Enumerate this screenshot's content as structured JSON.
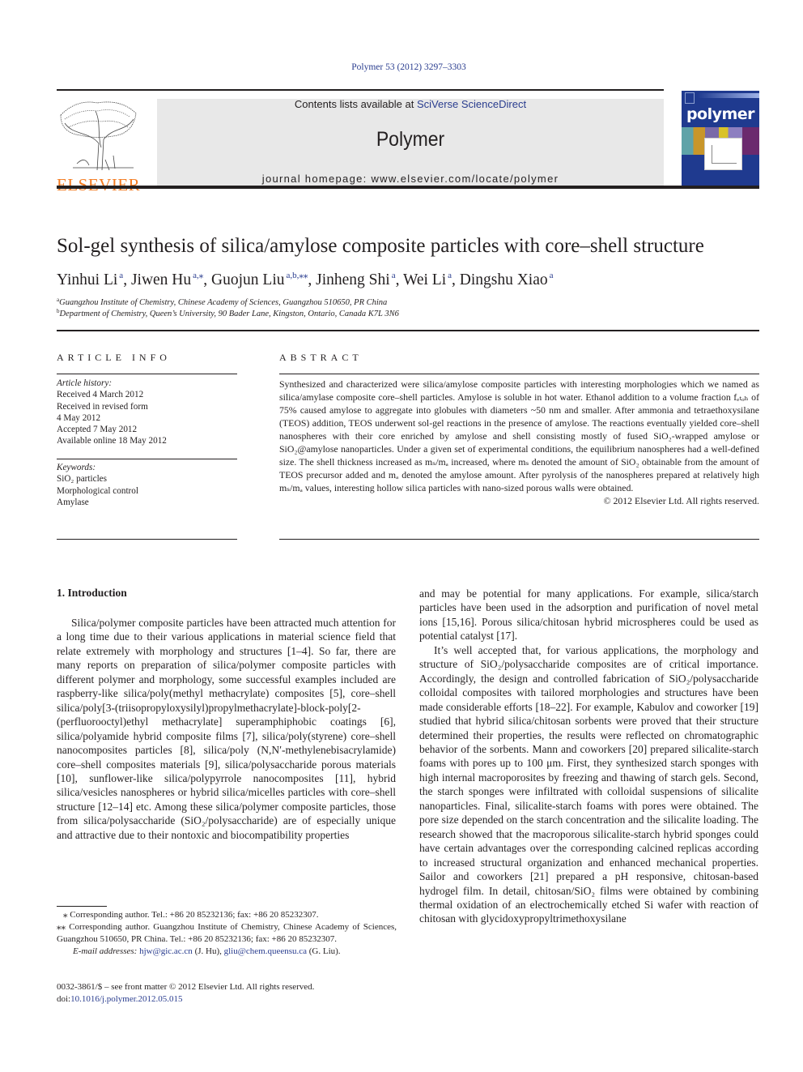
{
  "header": {
    "citation": "Polymer 53 (2012) 3297–3303",
    "contents_prefix": "Contents lists available at ",
    "contents_link": "SciVerse ScienceDirect",
    "journal_title": "Polymer",
    "homepage": "journal homepage: www.elsevier.com/locate/polymer",
    "publisher": "ELSEVIER",
    "cover_title": "polymer"
  },
  "colors": {
    "link": "#2a3d8f",
    "elsevier_orange": "#f47b20",
    "banner_bg": "#e8e8e8",
    "cover_bg": "#1f3a8f"
  },
  "article": {
    "title": "Sol-gel synthesis of silica/amylose composite particles with core–shell structure",
    "authors": [
      {
        "name": "Yinhui Li",
        "sup": "a"
      },
      {
        "name": "Jiwen Hu",
        "sup": "a,⁎"
      },
      {
        "name": "Guojun Liu",
        "sup": "a,b,⁎⁎"
      },
      {
        "name": "Jinheng Shi",
        "sup": "a"
      },
      {
        "name": "Wei Li",
        "sup": "a"
      },
      {
        "name": "Dingshu Xiao",
        "sup": "a"
      }
    ],
    "affiliations": [
      {
        "mark": "a",
        "text": "Guangzhou Institute of Chemistry, Chinese Academy of Sciences, Guangzhou 510650, PR China"
      },
      {
        "mark": "b",
        "text": "Department of Chemistry, Queen’s University, 90 Bader Lane, Kingston, Ontario, Canada K7L 3N6"
      }
    ]
  },
  "article_info": {
    "heading": "ARTICLE INFO",
    "history_label": "Article history:",
    "history": [
      "Received 4 March 2012",
      "Received in revised form",
      "4 May 2012",
      "Accepted 7 May 2012",
      "Available online 18 May 2012"
    ],
    "keywords_label": "Keywords:",
    "keywords": [
      "SiO₂ particles",
      "Morphological control",
      "Amylase"
    ]
  },
  "abstract": {
    "heading": "ABSTRACT",
    "text": "Synthesized and characterized were silica/amylose composite particles with interesting morphologies which we named as silica/amylase composite core–shell particles. Amylose is soluble in hot water. Ethanol addition to a volume fraction fₑₜₒₕ of 75% caused amylose to aggregate into globules with diameters ~50 nm and smaller. After ammonia and tetraethoxysilane (TEOS) addition, TEOS underwent sol-gel reactions in the presence of amylose. The reactions eventually yielded core–shell nanospheres with their core enriched by amylose and shell consisting mostly of fused SiO₂-wrapped amylose or SiO₂@amylose nanoparticles. Under a given set of experimental conditions, the equilibrium nanospheres had a well-defined size. The shell thickness increased as mₛ/mₐ increased, where mₛ denoted the amount of SiO₂ obtainable from the amount of TEOS precursor added and mₐ denoted the amylose amount. After pyrolysis of the nanospheres prepared at relatively high mₛ/mₐ values, interesting hollow silica particles with nano-sized porous walls were obtained.",
    "copyright": "© 2012 Elsevier Ltd. All rights reserved."
  },
  "body": {
    "intro_heading": "1.  Introduction",
    "left_paragraphs": [
      "Silica/polymer composite particles have been attracted much attention for a long time due to their various applications in material science field that relate extremely with morphology and structures [1–4]. So far, there are many reports on preparation of silica/polymer composite particles with different polymer and morphology, some successful examples included are raspberry-like silica/poly(methyl methacrylate) composites [5], core–shell silica/poly[3-(triisopropyloxysilyl)propylmethacrylate]-block-poly[2-(perfluorooctyl)ethyl methacrylate] superamphiphobic coatings [6], silica/polyamide hybrid composite films [7], silica/poly(styrene) core–shell nanocomposites particles [8], silica/poly (N,N′-methylenebisacrylamide) core–shell composites materials [9], silica/polysaccharide porous materials [10], sunflower-like silica/polypyrrole nanocomposites [11], hybrid silica/vesicles nanospheres or hybrid silica/micelles particles with core–shell structure [12–14] etc. Among these silica/polymer composite particles, those from silica/polysaccharide (SiO₂/polysaccharide) are of especially unique and attractive due to their nontoxic and biocompatibility properties"
    ],
    "right_paragraphs": [
      "and may be potential for many applications. For example, silica/starch particles have been used in the adsorption and purification of novel metal ions [15,16]. Porous silica/chitosan hybrid microspheres could be used as potential catalyst [17].",
      "It’s well accepted that, for various applications, the morphology and structure of SiO₂/polysaccharide composites are of critical importance. Accordingly, the design and controlled fabrication of SiO₂/polysaccharide colloidal composites with tailored morphologies and structures have been made considerable efforts [18–22]. For example, Kabulov and coworker [19] studied that hybrid silica/chitosan sorbents were proved that their structure determined their properties, the results were reflected on chromatographic behavior of the sorbents. Mann and coworkers [20] prepared silicalite-starch foams with pores up to 100 μm. First, they synthesized starch sponges with high internal macroporosites by freezing and thawing of starch gels. Second, the starch sponges were infiltrated with colloidal suspensions of silicalite nanoparticles. Final, silicalite-starch foams with pores were obtained. The pore size depended on the starch concentration and the silicalite loading. The research showed that the macroporous silicalite-starch hybrid sponges could have certain advantages over the corresponding calcined replicas according to increased structural organization and enhanced mechanical properties. Sailor and coworkers [21] prepared a pH responsive, chitosan-based hydrogel film. In detail, chitosan/SiO₂ films were obtained by combining thermal oxidation of an electrochemically etched Si wafer with reaction of chitosan with glycidoxypropyltrimethoxysilane"
    ]
  },
  "footnotes": {
    "star1": "⁎  Corresponding author. Tel.: +86 20 85232136; fax: +86 20 85232307.",
    "star2": "⁎⁎  Corresponding author. Guangzhou Institute of Chemistry, Chinese Academy of Sciences, Guangzhou 510650, PR China. Tel.: +86 20 85232136; fax: +86 20 85232307.",
    "email_label": "E-mail addresses:",
    "email1": "hjw@gic.ac.cn",
    "email1_who": " (J. Hu), ",
    "email2": "gliu@chem.queensu.ca",
    "email2_who": " (G. Liu).",
    "front_matter": "0032-3861/$ – see front matter © 2012 Elsevier Ltd. All rights reserved.",
    "doi_prefix": "doi:",
    "doi": "10.1016/j.polymer.2012.05.015"
  }
}
